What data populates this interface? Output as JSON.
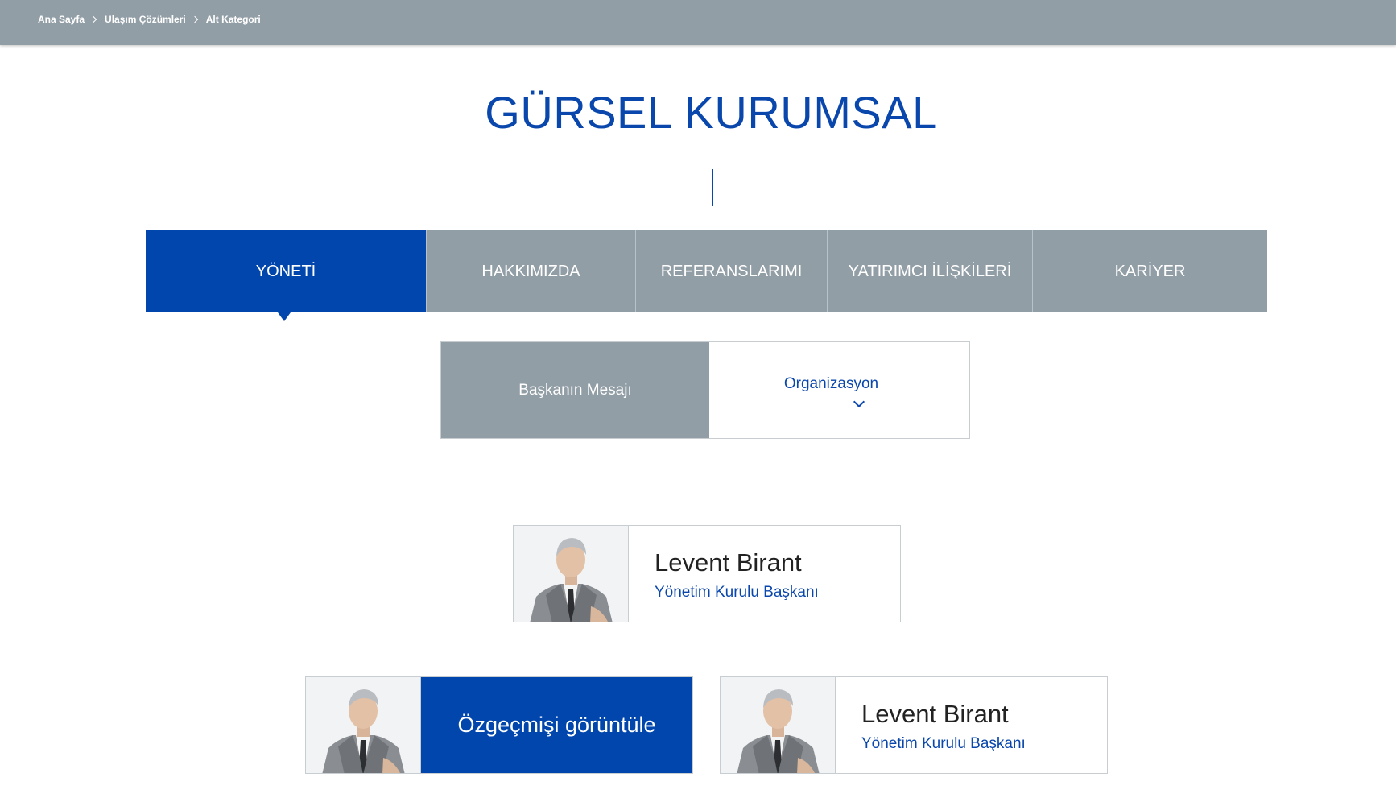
{
  "breadcrumb": {
    "items": [
      "Ana Sayfa",
      "Ulaşım Çözümleri",
      "Alt Kategori"
    ]
  },
  "header": {
    "title": "GÜRSEL KURUMSAL"
  },
  "tabs": [
    {
      "label": "YÖNETİ",
      "active": true
    },
    {
      "label": "HAKKIMIZDA",
      "active": false
    },
    {
      "label": "REFERANSLARIMI",
      "active": false
    },
    {
      "label": "YATIRIMCI İLİŞKİLERİ",
      "active": false
    },
    {
      "label": "KARİYER",
      "active": false
    }
  ],
  "subtabs": [
    {
      "label": "Başkanın Mesajı"
    },
    {
      "label": "Organizasyon"
    }
  ],
  "cards": [
    {
      "name": "Levent Birant",
      "role": "Yönetim Kurulu Başkanı"
    },
    {
      "cta": "Özgeçmişi görüntüle"
    },
    {
      "name": "Levent Birant",
      "role": "Yönetim Kurulu Başkanı"
    }
  ],
  "colors": {
    "brand_blue": "#0046ad",
    "bar_grey": "#929ea6",
    "title_blue": "#0a47ac"
  }
}
